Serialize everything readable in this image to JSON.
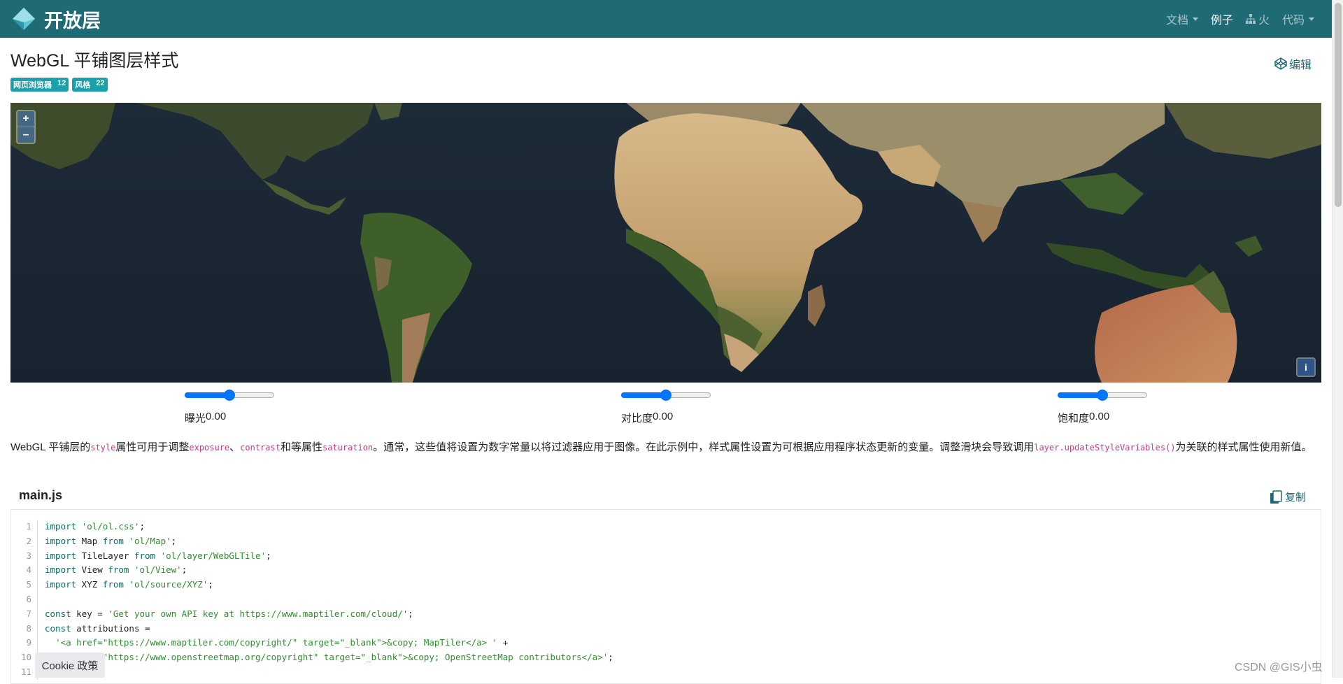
{
  "navbar": {
    "brand": "开放层",
    "items": [
      {
        "label": "文档",
        "dropdown": true,
        "active": false
      },
      {
        "label": "例子",
        "dropdown": false,
        "active": true
      },
      {
        "label": "火",
        "dropdown": false,
        "active": false,
        "icon": "sitemap-icon"
      },
      {
        "label": "代码",
        "dropdown": true,
        "active": false
      }
    ],
    "color": "#1f6b75"
  },
  "page": {
    "title": "WebGL 平铺图层样式",
    "edit_label": "编辑",
    "tags": [
      {
        "label": "网页浏览器",
        "count": "12"
      },
      {
        "label": "风格",
        "count": "22"
      }
    ]
  },
  "map": {
    "zoom_in": "+",
    "zoom_out": "–",
    "attribution_icon": "i"
  },
  "controls": [
    {
      "label": "曝光",
      "value": "0.00",
      "slider_level": 0.5
    },
    {
      "label": "对比度",
      "value": "0.00",
      "slider_level": 0.5
    },
    {
      "label": "饱和度",
      "value": "0.00",
      "slider_level": 0.5
    }
  ],
  "description": {
    "p1": "WebGL 平铺层的",
    "c1": "style",
    "p2": "属性可用于调整",
    "c2": "exposure",
    "p3": "、",
    "c3": "contrast",
    "p4": "和等属性",
    "c4": "saturation",
    "p5": "。通常，这些值将设置为数字常量以将过滤器应用于图像。在此示例中，样式属性设置为可根据应用程序状态更新的变量。调整滑块会导致调用",
    "c5": "layer.updateStyleVariables()",
    "p6": "为关联的样式属性使用新值。"
  },
  "code": {
    "filename": "main.js",
    "copy_label": "复制",
    "lines": [
      {
        "n": "1",
        "parts": [
          [
            "kw",
            "import"
          ],
          [
            "pl",
            " "
          ],
          [
            "str",
            "'ol/ol.css'"
          ],
          [
            "pl",
            ";"
          ]
        ]
      },
      {
        "n": "2",
        "parts": [
          [
            "kw",
            "import"
          ],
          [
            "pl",
            " Map "
          ],
          [
            "kw",
            "from"
          ],
          [
            "pl",
            " "
          ],
          [
            "str",
            "'ol/Map'"
          ],
          [
            "pl",
            ";"
          ]
        ]
      },
      {
        "n": "3",
        "parts": [
          [
            "kw",
            "import"
          ],
          [
            "pl",
            " TileLayer "
          ],
          [
            "kw",
            "from"
          ],
          [
            "pl",
            " "
          ],
          [
            "str",
            "'ol/layer/WebGLTile'"
          ],
          [
            "pl",
            ";"
          ]
        ]
      },
      {
        "n": "4",
        "parts": [
          [
            "kw",
            "import"
          ],
          [
            "pl",
            " View "
          ],
          [
            "kw",
            "from"
          ],
          [
            "pl",
            " "
          ],
          [
            "str",
            "'ol/View'"
          ],
          [
            "pl",
            ";"
          ]
        ]
      },
      {
        "n": "5",
        "parts": [
          [
            "kw",
            "import"
          ],
          [
            "pl",
            " XYZ "
          ],
          [
            "kw",
            "from"
          ],
          [
            "pl",
            " "
          ],
          [
            "str",
            "'ol/source/XYZ'"
          ],
          [
            "pl",
            ";"
          ]
        ]
      },
      {
        "n": "6",
        "parts": []
      },
      {
        "n": "7",
        "parts": [
          [
            "kw",
            "const"
          ],
          [
            "pl",
            " key = "
          ],
          [
            "str",
            "'Get your own API key at https://www.maptiler.com/cloud/'"
          ],
          [
            "pl",
            ";"
          ]
        ]
      },
      {
        "n": "8",
        "parts": [
          [
            "kw",
            "const"
          ],
          [
            "pl",
            " attributions ="
          ]
        ]
      },
      {
        "n": "9",
        "parts": [
          [
            "pl",
            "  "
          ],
          [
            "str",
            "'<a href=\"https://www.maptiler.com/copyright/\" target=\"_blank\">&copy; MapTiler</a> '"
          ],
          [
            "pl",
            " +"
          ]
        ]
      },
      {
        "n": "10",
        "parts": [
          [
            "pl",
            "  "
          ],
          [
            "str",
            "'<a href=\"https://www.openstreetmap.org/copyright\" target=\"_blank\">&copy; OpenStreetMap contributors</a>'"
          ],
          [
            "pl",
            ";"
          ]
        ]
      },
      {
        "n": "11",
        "parts": []
      }
    ]
  },
  "cookie_label": "Cookie 政策",
  "watermark": "CSDN @GIS小虫"
}
